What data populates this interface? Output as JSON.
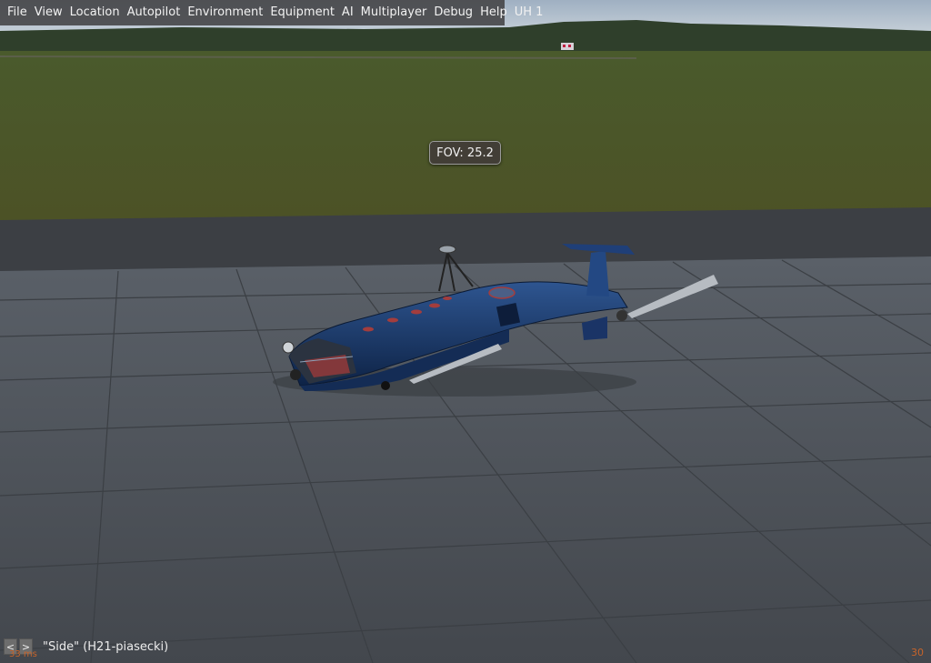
{
  "menubar": {
    "items": [
      "File",
      "View",
      "Location",
      "Autopilot",
      "Environment",
      "Equipment",
      "AI",
      "Multiplayer",
      "Debug",
      "Help",
      "UH 1"
    ]
  },
  "fov": {
    "text": "FOV: 25.2"
  },
  "view_bar": {
    "prev_label": "<",
    "next_label": ">",
    "view_text": "\"Side\" (H21-piasecki)"
  },
  "stats": {
    "latency": "33 ms",
    "fps": "30"
  },
  "colors": {
    "sky": "#aab6c4",
    "grass": "#4b5228",
    "taxiway": "#3e4146",
    "tarmac": "#4f555c",
    "aircraft": "#1d3a6a",
    "stat_text": "#c8642a"
  }
}
